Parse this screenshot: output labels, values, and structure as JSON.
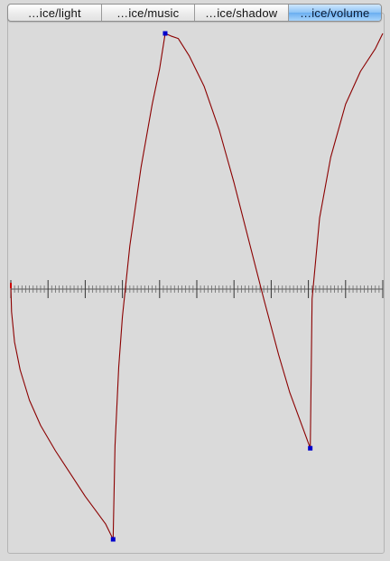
{
  "tabs": [
    {
      "label": "…ice/light",
      "selected": false
    },
    {
      "label": "…ice/music",
      "selected": false
    },
    {
      "label": "…ice/shadow",
      "selected": false
    },
    {
      "label": "…ice/volume",
      "selected": true
    }
  ],
  "colors": {
    "curve": "#8b0000",
    "control_point": "#0000cc",
    "axis": "#555555",
    "selected_tab": "#6aaef0"
  },
  "chart_data": {
    "type": "line",
    "title": "",
    "xlabel": "",
    "ylabel": "",
    "xlim": [
      0,
      10
    ],
    "ylim": [
      -1,
      1
    ],
    "grid": false,
    "major_ticks": 10,
    "minor_ticks_per_major": 10,
    "control_points": [
      {
        "x": 2.75,
        "y": -1.0
      },
      {
        "x": 4.15,
        "y": 1.0
      },
      {
        "x": 8.05,
        "y": -0.64
      }
    ],
    "series": [
      {
        "x": [
          0.0,
          0.02,
          0.1,
          0.25,
          0.5,
          0.8,
          1.2,
          1.6,
          2.0,
          2.3,
          2.55,
          2.75,
          2.8,
          2.9,
          3.0,
          3.2,
          3.5,
          3.8,
          4.0,
          4.15,
          4.3,
          4.5,
          4.8,
          5.2,
          5.6,
          6.0,
          6.4,
          6.8,
          7.2,
          7.5,
          7.8,
          8.05,
          8.1,
          8.3,
          8.6,
          9.0,
          9.4,
          9.8,
          10.0
        ],
        "y": [
          0.0,
          -0.1,
          -0.22,
          -0.33,
          -0.45,
          -0.55,
          -0.65,
          -0.74,
          -0.83,
          -0.89,
          -0.94,
          -1.0,
          -0.63,
          -0.32,
          -0.12,
          0.16,
          0.47,
          0.72,
          0.86,
          1.0,
          0.99,
          0.98,
          0.91,
          0.79,
          0.62,
          0.41,
          0.18,
          -0.05,
          -0.27,
          -0.42,
          -0.54,
          -0.64,
          -0.05,
          0.27,
          0.51,
          0.72,
          0.85,
          0.94,
          1.0
        ]
      }
    ]
  }
}
